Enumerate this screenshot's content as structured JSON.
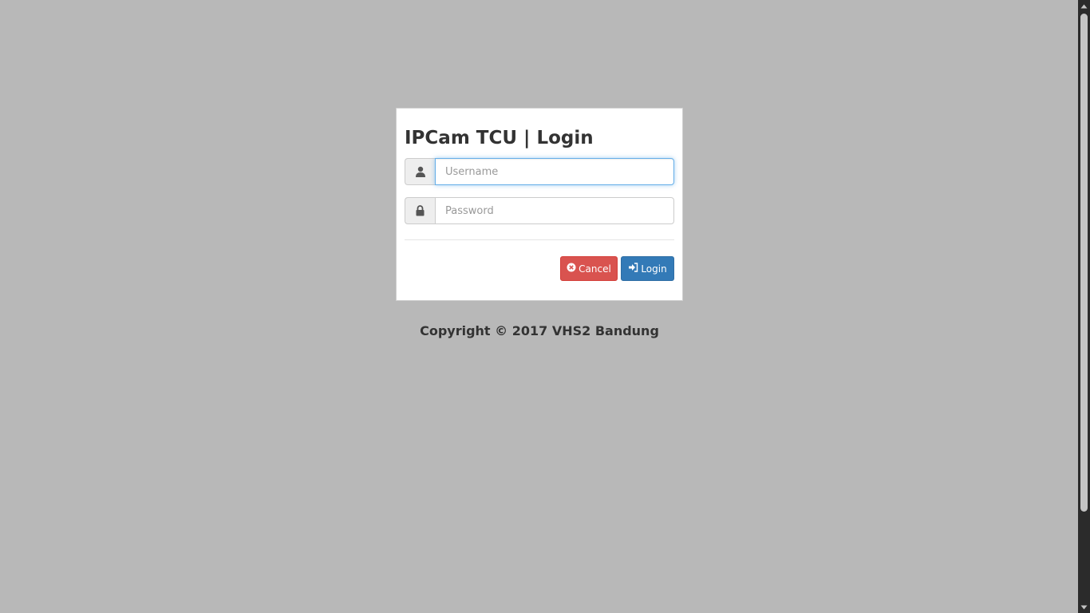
{
  "login": {
    "title": "IPCam TCU | Login",
    "username_placeholder": "Username",
    "password_placeholder": "Password",
    "cancel_label": "Cancel",
    "login_label": "Login",
    "username_icon": "user-icon",
    "password_icon": "lock-icon",
    "cancel_icon": "times-circle-icon",
    "login_icon": "sign-in-icon"
  },
  "footer": {
    "copyright": "Copyright © 2017 VHS2 Bandung"
  },
  "colors": {
    "background": "#b8b8b8",
    "cancel": "#d9534f",
    "login": "#337ab7",
    "focus_border": "#66afe9"
  }
}
